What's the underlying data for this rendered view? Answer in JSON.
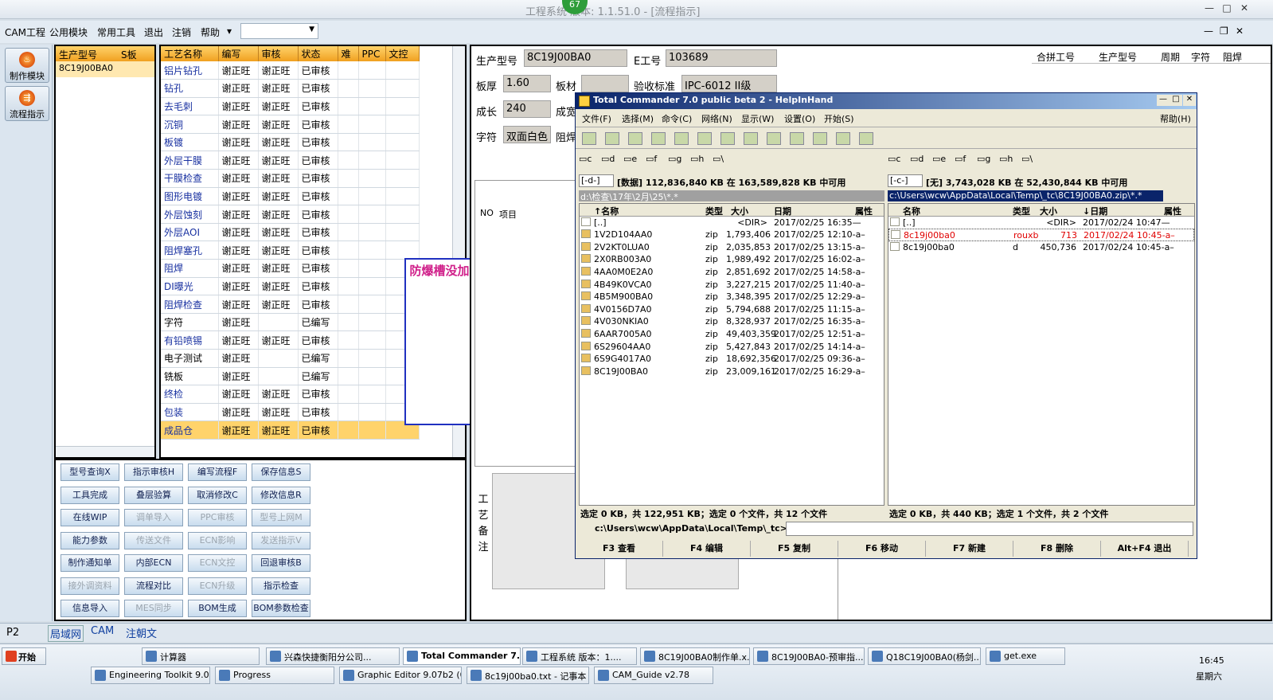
{
  "title": "工程系统 版本: 1.1.51.0 - [流程指示]",
  "badge": "67",
  "window_controls": {
    "min": "—",
    "max": "□",
    "close": "✕",
    "restore": "❐"
  },
  "menu": [
    "CAM工程",
    "公用模块",
    "常用工具",
    "退出",
    "注销",
    "帮助"
  ],
  "left_nav": [
    {
      "label": "制作模块"
    },
    {
      "label": "流程指示"
    }
  ],
  "panel1": {
    "col1": "生产型号",
    "col2": "S板",
    "row": "8C19J00BA0"
  },
  "process": {
    "headers": [
      "工艺名称",
      "编写",
      "审核",
      "状态",
      "难",
      "PPC",
      "文控"
    ],
    "rows": [
      [
        "铝片钻孔",
        "谢正旺",
        "谢正旺",
        "已审核"
      ],
      [
        "钻孔",
        "谢正旺",
        "谢正旺",
        "已审核"
      ],
      [
        "去毛刺",
        "谢正旺",
        "谢正旺",
        "已审核"
      ],
      [
        "沉铜",
        "谢正旺",
        "谢正旺",
        "已审核"
      ],
      [
        "板镀",
        "谢正旺",
        "谢正旺",
        "已审核"
      ],
      [
        "外层干膜",
        "谢正旺",
        "谢正旺",
        "已审核"
      ],
      [
        "干膜检查",
        "谢正旺",
        "谢正旺",
        "已审核"
      ],
      [
        "图形电镀",
        "谢正旺",
        "谢正旺",
        "已审核"
      ],
      [
        "外层蚀刻",
        "谢正旺",
        "谢正旺",
        "已审核"
      ],
      [
        "外层AOI",
        "谢正旺",
        "谢正旺",
        "已审核"
      ],
      [
        "阻焊塞孔",
        "谢正旺",
        "谢正旺",
        "已审核"
      ],
      [
        "阻焊",
        "谢正旺",
        "谢正旺",
        "已审核"
      ],
      [
        "DI曝光",
        "谢正旺",
        "谢正旺",
        "已审核"
      ],
      [
        "阻焊检查",
        "谢正旺",
        "谢正旺",
        "已审核"
      ],
      [
        "字符",
        "谢正旺",
        "",
        "已编写"
      ],
      [
        "有铅喷锡",
        "谢正旺",
        "谢正旺",
        "已审核"
      ],
      [
        "电子测试",
        "谢正旺",
        "",
        "已编写"
      ],
      [
        "铣板",
        "谢正旺",
        "",
        "已编写"
      ],
      [
        "终检",
        "谢正旺",
        "谢正旺",
        "已审核"
      ],
      [
        "包装",
        "谢正旺",
        "谢正旺",
        "已审核"
      ],
      [
        "成品仓",
        "谢正旺",
        "谢正旺",
        "已审核"
      ]
    ]
  },
  "note": "防爆槽没加流程",
  "buttons": [
    [
      "型号查询X",
      "指示审核H",
      "编写流程F",
      "保存信息S"
    ],
    [
      "工具完成",
      "叠层验算",
      "取消修改C",
      "修改信息R"
    ],
    [
      "在线WIP",
      "调单导入",
      "PPC审核",
      "型号上网M"
    ],
    [
      "能力参数",
      "传送文件",
      "ECN影响",
      "发送指示V"
    ],
    [
      "制作通知单",
      "内部ECN",
      "ECN文控",
      "回退审核B"
    ],
    [
      "接外调资料",
      "流程对比",
      "ECN升级",
      "指示检查"
    ],
    [
      "信息导入",
      "MES同步",
      "BOM生成",
      "BOM参数检查"
    ]
  ],
  "disabled_buttons": [
    "调单导入",
    "PPC审核",
    "型号上网M",
    "传送文件",
    "ECN影响",
    "发送指示V",
    "ECN文控",
    "接外调资料",
    "ECN升级",
    "MES同步"
  ],
  "info": {
    "prod_label": "生产型号",
    "prod": "8C19J00BA0",
    "e_label": "E工号",
    "e": "103689",
    "thick_label": "板厚",
    "thick": "1.60",
    "mat_label": "板材",
    "std_label": "验收标准",
    "std": "IPC-6012 II级",
    "grow_label": "成长",
    "grow": "240",
    "fin_label": "成宽",
    "char_label": "字符",
    "char": "双面白色",
    "mask_label": "阻焊",
    "no_label": "NO",
    "item_label": "项目",
    "process_note": "工艺备注"
  },
  "right_headers": [
    "合拼工号",
    "生产型号",
    "周期",
    "字符",
    "阻焊"
  ],
  "tc": {
    "title": "Total Commander 7.0 public beta 2 - HelpInHand",
    "menu": [
      "文件(F)",
      "选择(M)",
      "命令(C)",
      "网络(N)",
      "显示(W)",
      "设置(O)",
      "开始(S)"
    ],
    "help": "帮助(H)",
    "left_drive": "[-d-]",
    "left_info": "[数据]  112,836,840 KB 在 163,589,828 KB 中可用",
    "left_path": "d:\\检查\\17年\\2月\\25\\*.*",
    "right_drive": "[-c-]",
    "right_info": "[无]  3,743,028 KB 在 52,430,844 KB 中可用",
    "right_path": "c:\\Users\\wcw\\AppData\\Local\\Temp\\_tc\\8C19J00BA0.zip\\*.*",
    "cols": [
      "↑名称",
      "类型",
      "大小",
      "日期",
      "属性"
    ],
    "rcols": [
      "名称",
      "类型",
      "大小",
      "↓日期",
      "属性"
    ],
    "left_files": [
      [
        "[..]",
        "",
        "<DIR>",
        "2017/02/25 16:35—"
      ],
      [
        "1V2D104AA0",
        "zip",
        "1,793,406",
        "2017/02/25 12:10-a–"
      ],
      [
        "2V2KT0LUA0",
        "zip",
        "2,035,853",
        "2017/02/25 13:15-a–"
      ],
      [
        "2X0RB003A0",
        "zip",
        "1,989,492",
        "2017/02/25 16:02-a–"
      ],
      [
        "4AA0M0E2A0",
        "zip",
        "2,851,692",
        "2017/02/25 14:58-a–"
      ],
      [
        "4B49K0VCA0",
        "zip",
        "3,227,215",
        "2017/02/25 11:40-a–"
      ],
      [
        "4B5M900BA0",
        "zip",
        "3,348,395",
        "2017/02/25 12:29-a–"
      ],
      [
        "4V0156D7A0",
        "zip",
        "5,794,688",
        "2017/02/25 11:15-a–"
      ],
      [
        "4V030NKIA0",
        "zip",
        "8,328,937",
        "2017/02/25 16:35-a–"
      ],
      [
        "6AAR7005A0",
        "zip",
        "49,403,359",
        "2017/02/25 12:51-a–"
      ],
      [
        "6S29604AA0",
        "zip",
        "5,427,843",
        "2017/02/25 14:14-a–"
      ],
      [
        "6S9G4017A0",
        "zip",
        "18,692,356",
        "2017/02/25 09:36-a–"
      ],
      [
        "8C19J00BA0",
        "zip",
        "23,009,161",
        "2017/02/25 16:29-a–"
      ]
    ],
    "right_files": [
      [
        "[..]",
        "",
        "<DIR>",
        "2017/02/24 10:47—"
      ],
      [
        "8c19j00ba0",
        "rouxb",
        "713",
        "2017/02/24 10:45-a–"
      ],
      [
        "8c19j00ba0",
        "d",
        "450,736",
        "2017/02/24 10:45-a–"
      ]
    ],
    "left_status": "选定 0 KB，共 122,951 KB；选定 0 个文件，共 12 个文件",
    "right_status": "选定 0 KB，共 440 KB；选定 1 个文件，共 2 个文件",
    "cmd_path": "c:\\Users\\wcw\\AppData\\Local\\Temp\\_tc>",
    "fkeys": [
      "F3 查看",
      "F4 编辑",
      "F5 复制",
      "F6 移动",
      "F7 新建",
      "F8 删除",
      "Alt+F4 退出"
    ]
  },
  "status_tabs": [
    "P2",
    "局域网",
    "CAM",
    "注朝文"
  ],
  "taskbar": {
    "start": "开始",
    "row1": [
      "计算器",
      "兴森快捷衡阳分公司...",
      "Total Commander 7...",
      "工程系统 版本：1....",
      "8C19J00BA0制作单.x...",
      "8C19J00BA0-预审指...",
      "Q18C19J00BA0(杨剑...",
      "get.exe"
    ],
    "row2": [
      "Engineering Toolkit 9.07...",
      "Progress",
      "Graphic Editor 9.07b2 (0...",
      "8c19j00ba0.txt - 记事本",
      "CAM_Guide v2.78"
    ],
    "time": "16:45",
    "day": "星期六"
  }
}
